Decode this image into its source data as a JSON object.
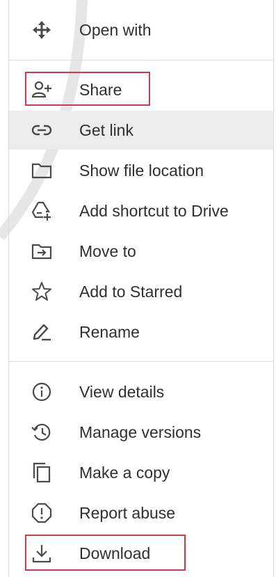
{
  "menu": {
    "items": [
      {
        "label": "Open with",
        "icon": "move-arrows-icon"
      },
      {
        "label": "Share",
        "icon": "person-add-icon"
      },
      {
        "label": "Get link",
        "icon": "link-icon"
      },
      {
        "label": "Show file location",
        "icon": "folder-icon"
      },
      {
        "label": "Add shortcut to Drive",
        "icon": "add-to-drive-icon"
      },
      {
        "label": "Move to",
        "icon": "move-to-folder-icon"
      },
      {
        "label": "Add to Starred",
        "icon": "star-icon"
      },
      {
        "label": "Rename",
        "icon": "pencil-icon"
      },
      {
        "label": "View details",
        "icon": "info-icon"
      },
      {
        "label": "Manage versions",
        "icon": "history-icon"
      },
      {
        "label": "Make a copy",
        "icon": "copy-icon"
      },
      {
        "label": "Report abuse",
        "icon": "report-icon"
      },
      {
        "label": "Download",
        "icon": "download-icon"
      }
    ],
    "hovered_item": "Get link",
    "highlighted_items": [
      "Share",
      "Download"
    ]
  },
  "colors": {
    "highlight_border": "#d23a4a",
    "hover_background": "#ececec",
    "text": "#2f2f2f",
    "icon": "#4a4a4a"
  }
}
